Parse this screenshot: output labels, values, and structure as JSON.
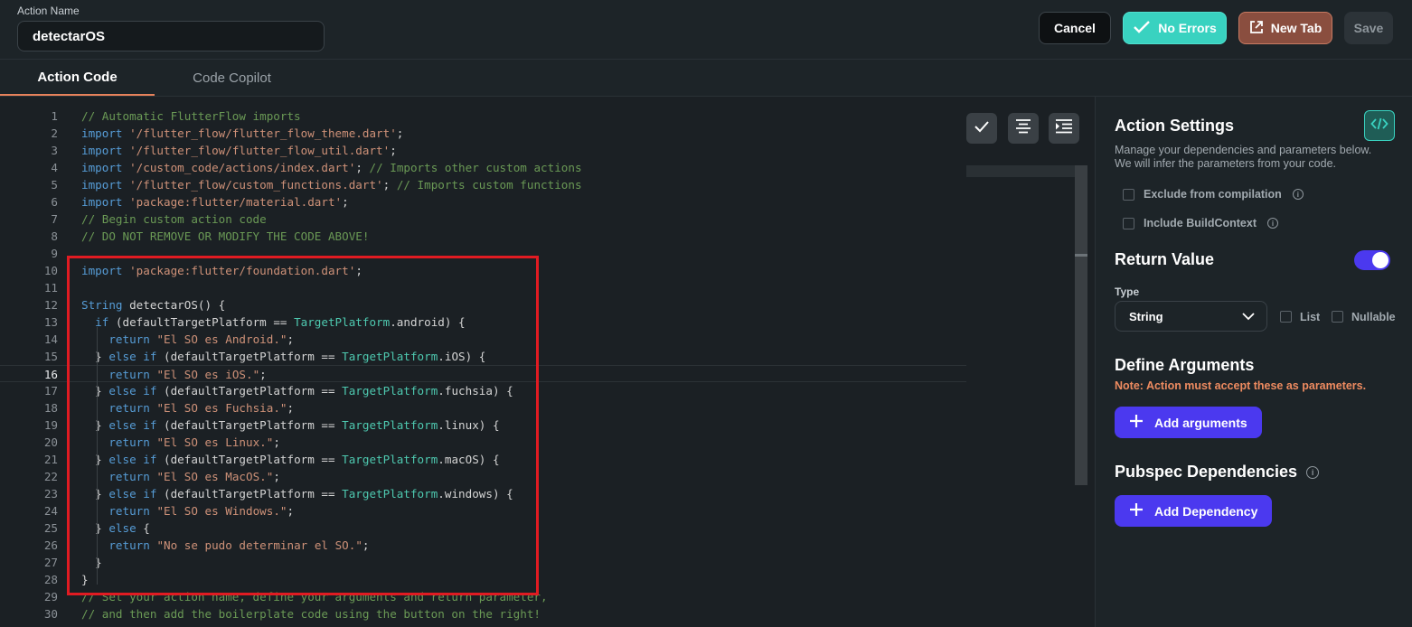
{
  "header": {
    "action_name_label": "Action Name",
    "action_name_value": "detectarOS",
    "cancel_label": "Cancel",
    "no_errors_label": "No Errors",
    "new_tab_label": "New Tab",
    "save_label": "Save"
  },
  "tabs": [
    {
      "label": "Action Code",
      "active": true
    },
    {
      "label": "Code Copilot",
      "active": false
    }
  ],
  "editor": {
    "active_line": 16,
    "lines": [
      {
        "n": "1",
        "tokens": [
          [
            "c",
            "// Automatic FlutterFlow imports"
          ]
        ]
      },
      {
        "n": "2",
        "tokens": [
          [
            "k",
            "import"
          ],
          [
            "p",
            " "
          ],
          [
            "s",
            "'/flutter_flow/flutter_flow_theme.dart'"
          ],
          [
            "p",
            ";"
          ]
        ]
      },
      {
        "n": "3",
        "tokens": [
          [
            "k",
            "import"
          ],
          [
            "p",
            " "
          ],
          [
            "s",
            "'/flutter_flow/flutter_flow_util.dart'"
          ],
          [
            "p",
            ";"
          ]
        ]
      },
      {
        "n": "4",
        "tokens": [
          [
            "k",
            "import"
          ],
          [
            "p",
            " "
          ],
          [
            "s",
            "'/custom_code/actions/index.dart'"
          ],
          [
            "p",
            "; "
          ],
          [
            "c",
            "// Imports other custom actions"
          ]
        ]
      },
      {
        "n": "5",
        "tokens": [
          [
            "k",
            "import"
          ],
          [
            "p",
            " "
          ],
          [
            "s",
            "'/flutter_flow/custom_functions.dart'"
          ],
          [
            "p",
            "; "
          ],
          [
            "c",
            "// Imports custom functions"
          ]
        ]
      },
      {
        "n": "6",
        "tokens": [
          [
            "k",
            "import"
          ],
          [
            "p",
            " "
          ],
          [
            "s",
            "'package:flutter/material.dart'"
          ],
          [
            "p",
            ";"
          ]
        ]
      },
      {
        "n": "7",
        "tokens": [
          [
            "c",
            "// Begin custom action code"
          ]
        ]
      },
      {
        "n": "8",
        "tokens": [
          [
            "c",
            "// DO NOT REMOVE OR MODIFY THE CODE ABOVE!"
          ]
        ]
      },
      {
        "n": "9",
        "tokens": []
      },
      {
        "n": "10",
        "tokens": [
          [
            "k",
            "import"
          ],
          [
            "p",
            " "
          ],
          [
            "s",
            "'package:flutter/foundation.dart'"
          ],
          [
            "p",
            ";"
          ]
        ]
      },
      {
        "n": "11",
        "tokens": []
      },
      {
        "n": "12",
        "tokens": [
          [
            "k",
            "String"
          ],
          [
            "p",
            " detectarOS() {"
          ]
        ]
      },
      {
        "n": "13",
        "tokens": [
          [
            "p",
            "  "
          ],
          [
            "k",
            "if"
          ],
          [
            "p",
            " (defaultTargetPlatform == "
          ],
          [
            "t",
            "TargetPlatform"
          ],
          [
            "p",
            ".android) {"
          ]
        ]
      },
      {
        "n": "14",
        "tokens": [
          [
            "p",
            "    "
          ],
          [
            "k",
            "return"
          ],
          [
            "p",
            " "
          ],
          [
            "s",
            "\"El SO es Android.\""
          ],
          [
            "p",
            ";"
          ]
        ]
      },
      {
        "n": "15",
        "tokens": [
          [
            "p",
            "  } "
          ],
          [
            "k",
            "else if"
          ],
          [
            "p",
            " (defaultTargetPlatform == "
          ],
          [
            "t",
            "TargetPlatform"
          ],
          [
            "p",
            ".iOS) {"
          ]
        ]
      },
      {
        "n": "16",
        "tokens": [
          [
            "p",
            "    "
          ],
          [
            "k",
            "return"
          ],
          [
            "p",
            " "
          ],
          [
            "s",
            "\"El SO es iOS.\""
          ],
          [
            "p",
            ";"
          ]
        ]
      },
      {
        "n": "17",
        "tokens": [
          [
            "p",
            "  } "
          ],
          [
            "k",
            "else if"
          ],
          [
            "p",
            " (defaultTargetPlatform == "
          ],
          [
            "t",
            "TargetPlatform"
          ],
          [
            "p",
            ".fuchsia) {"
          ]
        ]
      },
      {
        "n": "18",
        "tokens": [
          [
            "p",
            "    "
          ],
          [
            "k",
            "return"
          ],
          [
            "p",
            " "
          ],
          [
            "s",
            "\"El SO es Fuchsia.\""
          ],
          [
            "p",
            ";"
          ]
        ]
      },
      {
        "n": "19",
        "tokens": [
          [
            "p",
            "  } "
          ],
          [
            "k",
            "else if"
          ],
          [
            "p",
            " (defaultTargetPlatform == "
          ],
          [
            "t",
            "TargetPlatform"
          ],
          [
            "p",
            ".linux) {"
          ]
        ]
      },
      {
        "n": "20",
        "tokens": [
          [
            "p",
            "    "
          ],
          [
            "k",
            "return"
          ],
          [
            "p",
            " "
          ],
          [
            "s",
            "\"El SO es Linux.\""
          ],
          [
            "p",
            ";"
          ]
        ]
      },
      {
        "n": "21",
        "tokens": [
          [
            "p",
            "  } "
          ],
          [
            "k",
            "else if"
          ],
          [
            "p",
            " (defaultTargetPlatform == "
          ],
          [
            "t",
            "TargetPlatform"
          ],
          [
            "p",
            ".macOS) {"
          ]
        ]
      },
      {
        "n": "22",
        "tokens": [
          [
            "p",
            "    "
          ],
          [
            "k",
            "return"
          ],
          [
            "p",
            " "
          ],
          [
            "s",
            "\"El SO es MacOS.\""
          ],
          [
            "p",
            ";"
          ]
        ]
      },
      {
        "n": "23",
        "tokens": [
          [
            "p",
            "  } "
          ],
          [
            "k",
            "else if"
          ],
          [
            "p",
            " (defaultTargetPlatform == "
          ],
          [
            "t",
            "TargetPlatform"
          ],
          [
            "p",
            ".windows) {"
          ]
        ]
      },
      {
        "n": "24",
        "tokens": [
          [
            "p",
            "    "
          ],
          [
            "k",
            "return"
          ],
          [
            "p",
            " "
          ],
          [
            "s",
            "\"El SO es Windows.\""
          ],
          [
            "p",
            ";"
          ]
        ]
      },
      {
        "n": "25",
        "tokens": [
          [
            "p",
            "  } "
          ],
          [
            "k",
            "else"
          ],
          [
            "p",
            " {"
          ]
        ]
      },
      {
        "n": "26",
        "tokens": [
          [
            "p",
            "    "
          ],
          [
            "k",
            "return"
          ],
          [
            "p",
            " "
          ],
          [
            "s",
            "\"No se pudo determinar el SO.\""
          ],
          [
            "p",
            ";"
          ]
        ]
      },
      {
        "n": "27",
        "tokens": [
          [
            "p",
            "  }"
          ]
        ]
      },
      {
        "n": "28",
        "tokens": [
          [
            "p",
            "}"
          ]
        ]
      },
      {
        "n": "29",
        "tokens": [
          [
            "c",
            "// Set your action name, define your arguments and return parameter,"
          ]
        ]
      },
      {
        "n": "30",
        "tokens": [
          [
            "c",
            "// and then add the boilerplate code using the button on the right!"
          ]
        ]
      }
    ],
    "icons": [
      "check-icon",
      "align-center-icon",
      "indent-icon"
    ]
  },
  "settings": {
    "title": "Action Settings",
    "description": "Manage your dependencies and parameters below. We will infer the parameters from your code.",
    "exclude_label": "Exclude from compilation",
    "include_context_label": "Include BuildContext",
    "return_value_title": "Return Value",
    "return_value_enabled": true,
    "type_label": "Type",
    "type_value": "String",
    "list_label": "List",
    "nullable_label": "Nullable",
    "define_args_title": "Define Arguments",
    "note": "Note: Action must accept these as parameters.",
    "add_arguments_label": "Add arguments",
    "pubspec_title": "Pubspec Dependencies",
    "add_dependency_label": "Add Dependency"
  },
  "colors": {
    "accent_teal": "#39d2c0",
    "accent_purple": "#4b39ef",
    "note_orange": "#ee8b60",
    "highlight_red": "#e11b22",
    "tab_underline": "#e5815b"
  }
}
